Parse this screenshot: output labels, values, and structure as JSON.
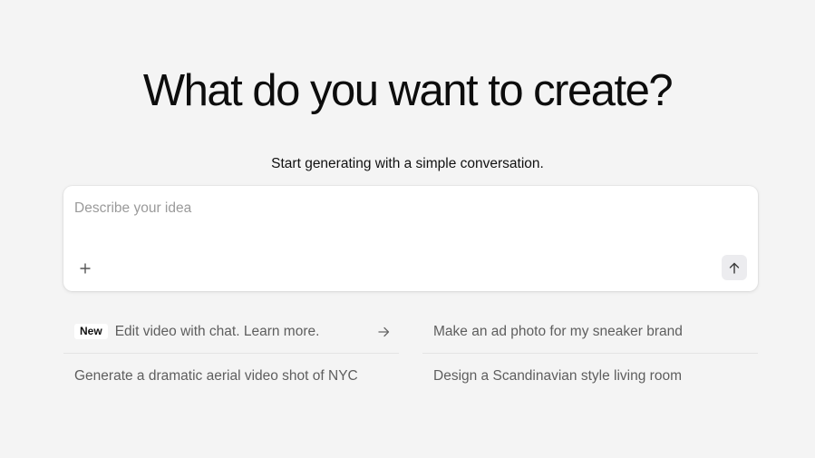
{
  "hero": {
    "title": "What do you want to create?",
    "subtitle": "Start generating with a simple conversation."
  },
  "prompt": {
    "placeholder": "Describe your idea",
    "value": "",
    "add_icon": "plus-icon",
    "send_icon": "arrow-up-icon"
  },
  "suggestions": [
    {
      "badge": "New",
      "text": "Edit video with chat. Learn more.",
      "icon": "arrow-right-icon"
    },
    {
      "text": "Make an ad photo for my sneaker brand"
    },
    {
      "text": "Generate a dramatic aerial video shot of NYC"
    },
    {
      "text": "Design a Scandinavian style living room"
    }
  ],
  "colors": {
    "background": "#f4f4f4",
    "card": "#ffffff",
    "text_primary": "#0d0d0d",
    "text_secondary": "#5e5e5e",
    "placeholder": "#9a9a9a",
    "send_button_bg": "#ececef",
    "divider": "#e3e3e3"
  }
}
